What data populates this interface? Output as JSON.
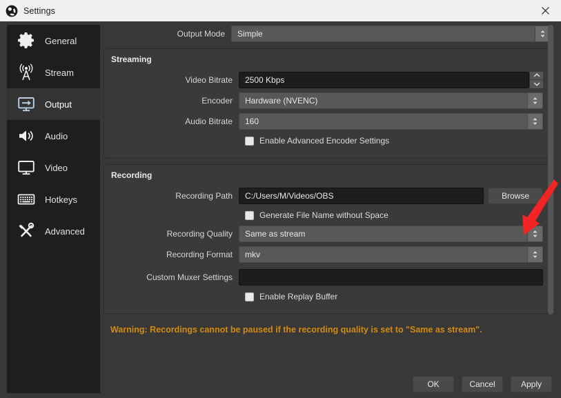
{
  "window": {
    "title": "Settings",
    "logo_icon": "obs-logo-icon",
    "close_icon": "close-icon"
  },
  "sidebar": {
    "items": [
      {
        "label": "General",
        "icon": "gear-icon",
        "selected": false
      },
      {
        "label": "Stream",
        "icon": "broadcast-icon",
        "selected": false
      },
      {
        "label": "Output",
        "icon": "monitor-arrow-icon",
        "selected": true
      },
      {
        "label": "Audio",
        "icon": "speaker-icon",
        "selected": false
      },
      {
        "label": "Video",
        "icon": "display-icon",
        "selected": false
      },
      {
        "label": "Hotkeys",
        "icon": "keyboard-icon",
        "selected": false
      },
      {
        "label": "Advanced",
        "icon": "tools-icon",
        "selected": false
      }
    ]
  },
  "output_mode": {
    "label": "Output Mode",
    "value": "Simple"
  },
  "streaming": {
    "title": "Streaming",
    "video_bitrate": {
      "label": "Video Bitrate",
      "value": "2500 Kbps"
    },
    "encoder": {
      "label": "Encoder",
      "value": "Hardware (NVENC)"
    },
    "audio_bitrate": {
      "label": "Audio Bitrate",
      "value": "160"
    },
    "advanced_encoder": {
      "label": "Enable Advanced Encoder Settings",
      "checked": false
    }
  },
  "recording": {
    "title": "Recording",
    "recording_path": {
      "label": "Recording Path",
      "value": "C:/Users/M/Videos/OBS"
    },
    "browse_label": "Browse",
    "generate_file_name": {
      "label": "Generate File Name without Space",
      "checked": false
    },
    "recording_quality": {
      "label": "Recording Quality",
      "value": "Same as stream"
    },
    "recording_format": {
      "label": "Recording Format",
      "value": "mkv"
    },
    "custom_muxer": {
      "label": "Custom Muxer Settings",
      "value": ""
    },
    "replay_buffer": {
      "label": "Enable Replay Buffer",
      "checked": false
    }
  },
  "warning": {
    "text": "Warning: Recordings cannot be paused if the recording quality is set to \"Same as stream\".",
    "color": "#d38a12"
  },
  "buttons": {
    "ok": "OK",
    "cancel": "Cancel",
    "apply": "Apply"
  },
  "annotation": {
    "icon": "red-arrow-annotation",
    "color": "#f22424",
    "points_to": "recording-quality-dropdown"
  }
}
